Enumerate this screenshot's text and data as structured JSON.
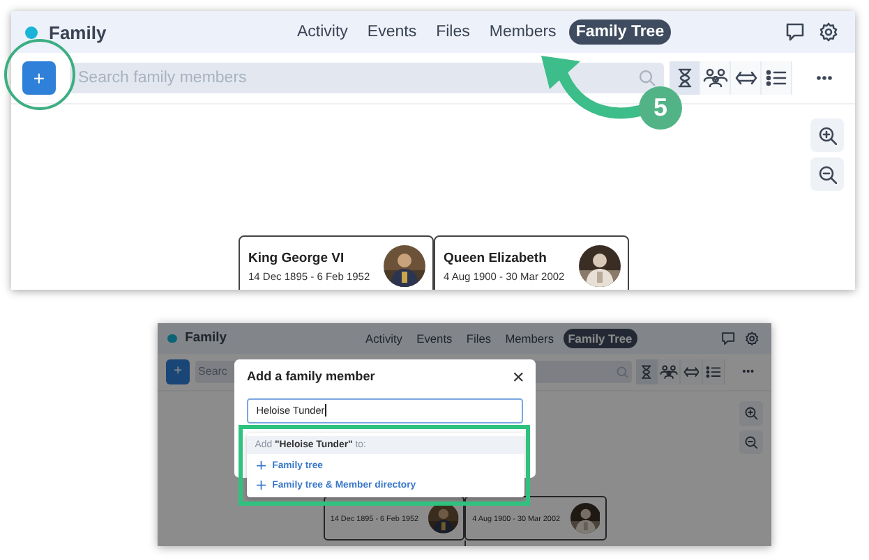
{
  "screens": [
    {
      "app": "Family",
      "nav": [
        {
          "label": "Activity",
          "selected": false
        },
        {
          "label": "Events",
          "selected": false
        },
        {
          "label": "Files",
          "selected": false
        },
        {
          "label": "Members",
          "selected": false
        },
        {
          "label": "Family Tree",
          "selected": true
        }
      ],
      "add_button": "+",
      "search": {
        "placeholder": "Search family members"
      },
      "view_buttons": [
        {
          "kind": "hourglass",
          "selected": true
        },
        {
          "kind": "people",
          "selected": false
        },
        {
          "kind": "link",
          "selected": false
        },
        {
          "kind": "list",
          "selected": false
        }
      ],
      "people": [
        {
          "name": "King George VI",
          "dates": "14 Dec 1895 - 6 Feb 1952"
        },
        {
          "name": "Queen Elizabeth",
          "dates": "4 Aug 1900 - 30 Mar 2002"
        }
      ]
    },
    {
      "app": "Family",
      "nav": [
        {
          "label": "Activity",
          "selected": false
        },
        {
          "label": "Events",
          "selected": false
        },
        {
          "label": "Files",
          "selected": false
        },
        {
          "label": "Members",
          "selected": false
        },
        {
          "label": "Family Tree",
          "selected": true
        }
      ],
      "add_button": "+",
      "search": {
        "placeholder": "Searc"
      },
      "view_buttons": [
        {
          "kind": "hourglass",
          "selected": true
        },
        {
          "kind": "people",
          "selected": false
        },
        {
          "kind": "link",
          "selected": false
        },
        {
          "kind": "list",
          "selected": false
        }
      ],
      "people": [
        {
          "dates": "14 Dec 1895 - 6 Feb 1952"
        },
        {
          "dates": "4 Aug 1900 - 30 Mar 2002"
        }
      ],
      "dialog": {
        "title": "Add a family member",
        "value": "Heloise Tunder",
        "suggestion_header": "Add **\"Heloise Tunder\"** to:",
        "options": [
          {
            "label": "Family tree"
          },
          {
            "label": "Family tree & Member directory"
          }
        ]
      }
    }
  ],
  "annotations": [
    {
      "kind": "ring"
    },
    {
      "kind": "arrow"
    },
    {
      "kind": "step",
      "label": "5"
    },
    {
      "kind": "frame"
    }
  ]
}
